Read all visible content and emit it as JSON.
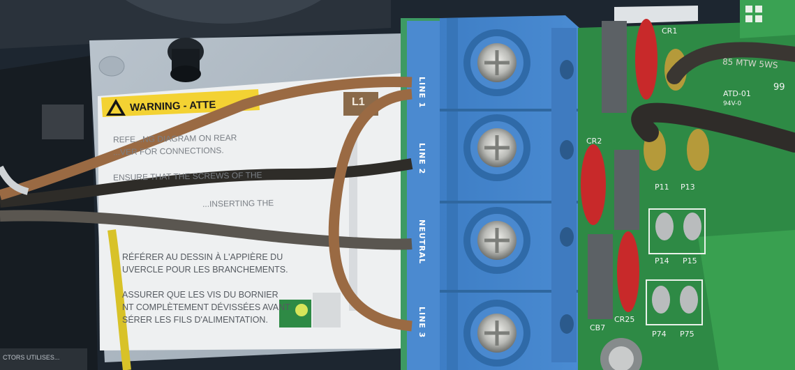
{
  "terminal_block": {
    "labels": [
      "LINE 1",
      "LINE 2",
      "NEUTRAL",
      "LINE 3"
    ],
    "body_color": "#3f7fc6"
  },
  "warning_label": {
    "header": "WARNING - ATTE",
    "tag": "L1",
    "en_lines": [
      "REFE...NG DIAGRAM ON REAR",
      "...VER FOR CONNECTIONS.",
      "ENSURE THAT THE SCREWS OF THE",
      "...INSERTING THE"
    ],
    "fr_lines": [
      "RÉFÉRER AU DESSIN À L'APPIÈRE DU",
      "UVERCLE POUR LES BRANCHEMENTS.",
      "ASSURER QUE LES VIS DU BORNIER",
      "NT COMPLÈTEMENT DÉVISSÉES AVANT",
      "SÉRER LES FILS D'ALIMENTATION."
    ]
  },
  "pcb": {
    "labels": [
      "CR1",
      "CR2",
      "CR25",
      "P11",
      "P13",
      "P14",
      "P15",
      "P74",
      "P75",
      "CB7",
      "ATD-01",
      "94V-0",
      "99"
    ],
    "wire_print": "85 MTW 5WS"
  },
  "bottom_text": "CTORS UTILISES...",
  "colors": {
    "pcb_green": "#2d8a43",
    "wire_brown": "#9a6a43",
    "wire_black": "#2e2c28",
    "wire_yellow": "#d8c228"
  }
}
